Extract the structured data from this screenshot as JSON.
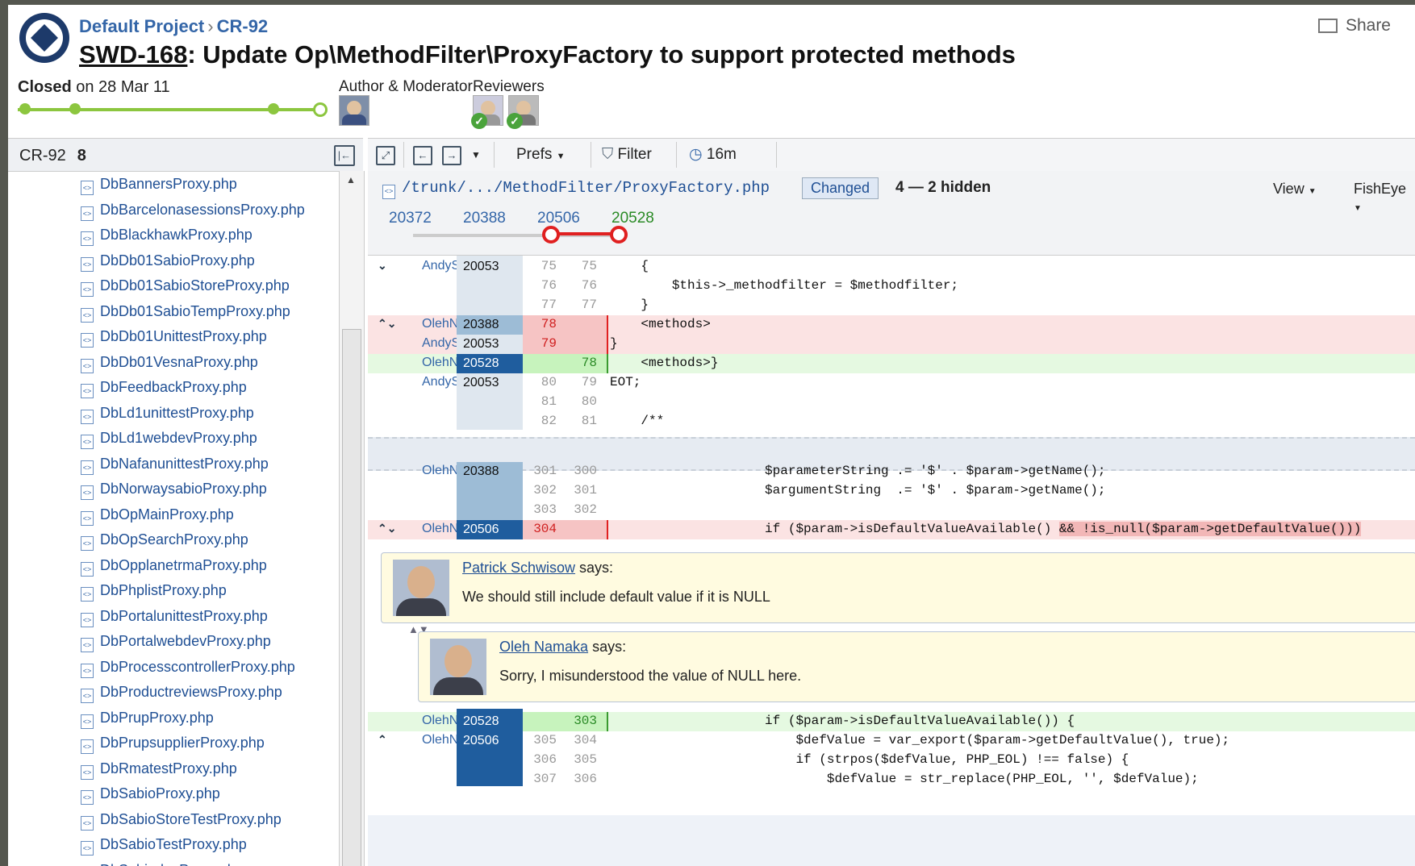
{
  "header": {
    "project": "Default Project",
    "review_id": "CR-92",
    "issue_key": "SWD-168",
    "title_rest": ": Update Op\\MethodFilter\\ProxyFactory to support protected methods",
    "share": "Share",
    "status_word": "Closed",
    "status_rest": " on 28 Mar 11",
    "author_label": "Author & Moderator",
    "reviewers_label": "Reviewers"
  },
  "sidebar": {
    "review_id": "CR-92",
    "file_count": "8",
    "files": [
      "DbBannersProxy.php",
      "DbBarcelonasessionsProxy.php",
      "DbBlackhawkProxy.php",
      "DbDb01SabioProxy.php",
      "DbDb01SabioStoreProxy.php",
      "DbDb01SabioTempProxy.php",
      "DbDb01UnittestProxy.php",
      "DbDb01VesnaProxy.php",
      "DbFeedbackProxy.php",
      "DbLd1unittestProxy.php",
      "DbLd1webdevProxy.php",
      "DbNafanunittestProxy.php",
      "DbNorwaysabioProxy.php",
      "DbOpMainProxy.php",
      "DbOpSearchProxy.php",
      "DbOpplanetrmaProxy.php",
      "DbPhplistProxy.php",
      "DbPortalunittestProxy.php",
      "DbPortalwebdevProxy.php",
      "DbProcesscontrollerProxy.php",
      "DbProductreviewsProxy.php",
      "DbPrupProxy.php",
      "DbPrupsupplierProxy.php",
      "DbRmatestProxy.php",
      "DbSabioProxy.php",
      "DbSabioStoreTestProxy.php",
      "DbSabioTestProxy.php",
      "DbSabiodevProxy.php"
    ]
  },
  "toolbar": {
    "prefs": "Prefs",
    "filter": "Filter",
    "time": "16m"
  },
  "file_header": {
    "path": "/trunk/.../MethodFilter/ProxyFactory.php",
    "badge": "Changed",
    "hidden": "4 — 2 hidden",
    "view": "View",
    "fisheye": "FishEye",
    "revisions": [
      "20372",
      "20388",
      "20506",
      "20528"
    ]
  },
  "diff": {
    "block1": [
      {
        "arrow": "⌄",
        "author": "AndyS",
        "rev": "20053",
        "a": "75",
        "b": "75",
        "code": "    {",
        "type": "ctx",
        "rc": "c1"
      },
      {
        "arrow": "",
        "author": "",
        "rev": "",
        "a": "76",
        "b": "76",
        "code": "        $this->_methodfilter = $methodfilter;",
        "type": "ctx",
        "rc": "c1"
      },
      {
        "arrow": "",
        "author": "",
        "rev": "",
        "a": "77",
        "b": "77",
        "code": "    }",
        "type": "ctx",
        "rc": "c1"
      },
      {
        "arrow": "⌃⌄",
        "author": "OlehN",
        "rev": "20388",
        "a": "78",
        "b": "",
        "code": "    <methods>",
        "type": "del",
        "rc": "c2"
      },
      {
        "arrow": "",
        "author": "AndyS",
        "rev": "20053",
        "a": "79",
        "b": "",
        "code": "}",
        "type": "del",
        "rc": "c1"
      },
      {
        "arrow": "",
        "author": "OlehN",
        "rev": "20528",
        "a": "",
        "b": "78",
        "code": "    <methods>}",
        "type": "add",
        "rc": "c3"
      },
      {
        "arrow": "",
        "author": "AndyS",
        "rev": "20053",
        "a": "80",
        "b": "79",
        "code": "EOT;",
        "type": "ctx",
        "rc": "c1"
      },
      {
        "arrow": "",
        "author": "",
        "rev": "",
        "a": "81",
        "b": "80",
        "code": "",
        "type": "ctx",
        "rc": "c1"
      },
      {
        "arrow": "",
        "author": "",
        "rev": "",
        "a": "82",
        "b": "81",
        "code": "    /**",
        "type": "ctx",
        "rc": "c1"
      }
    ],
    "block2": [
      {
        "arrow": "",
        "author": "OlehN",
        "rev": "20388",
        "a": "301",
        "b": "300",
        "code": "                    $parameterString .= '$' . $param->getName();",
        "type": "ctx",
        "rc": "c2"
      },
      {
        "arrow": "",
        "author": "",
        "rev": "",
        "a": "302",
        "b": "301",
        "code": "                    $argumentString  .= '$' . $param->getName();",
        "type": "ctx",
        "rc": "c2"
      },
      {
        "arrow": "",
        "author": "",
        "rev": "",
        "a": "303",
        "b": "302",
        "code": "",
        "type": "ctx",
        "rc": "c2"
      },
      {
        "arrow": "⌃⌄",
        "author": "OlehN",
        "rev": "20506",
        "a": "304",
        "b": "",
        "code": "                    if ($param->isDefaultValueAvailable() ",
        "hl": "&& !is_null($param->getDefaultValue()))",
        "type": "del",
        "rc": "c3"
      }
    ],
    "block3": [
      {
        "arrow": "",
        "author": "OlehN",
        "rev": "20528",
        "a": "",
        "b": "303",
        "code": "                    if ($param->isDefaultValueAvailable()) {",
        "type": "add",
        "rc": "c3"
      },
      {
        "arrow": "⌃",
        "author": "OlehN",
        "rev": "20506",
        "a": "305",
        "b": "304",
        "code": "                        $defValue = var_export($param->getDefaultValue(), true);",
        "type": "ctx",
        "rc": "c3"
      },
      {
        "arrow": "",
        "author": "",
        "rev": "",
        "a": "306",
        "b": "305",
        "code": "                        if (strpos($defValue, PHP_EOL) !== false) {",
        "type": "ctx",
        "rc": "c3"
      },
      {
        "arrow": "",
        "author": "",
        "rev": "",
        "a": "307",
        "b": "306",
        "code": "                            $defValue = str_replace(PHP_EOL, '', $defValue);",
        "type": "ctx",
        "rc": "c3"
      }
    ]
  },
  "comments": [
    {
      "author": "Patrick Schwisow",
      "says": " says:",
      "text": "We should still include default value if it is NULL"
    },
    {
      "author": "Oleh Namaka",
      "says": " says:",
      "text": "Sorry, I misunderstood the value of NULL here."
    }
  ]
}
